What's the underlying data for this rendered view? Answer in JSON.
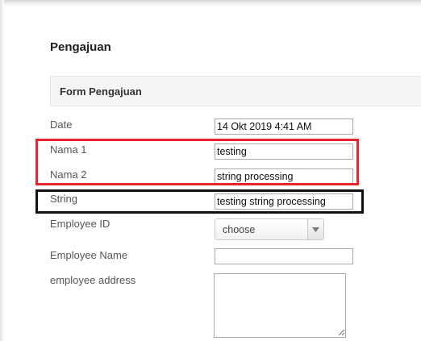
{
  "page": {
    "title": "Pengajuan"
  },
  "form": {
    "section_title": "Form Pengajuan",
    "fields": {
      "date": {
        "label": "Date",
        "value": "14 Okt 2019 4:41 AM"
      },
      "nama1": {
        "label": "Nama 1",
        "value": "testing"
      },
      "nama2": {
        "label": "Nama 2",
        "value": "string processing"
      },
      "string": {
        "label": "String",
        "value": "testing string processing"
      },
      "employee_id": {
        "label": "Employee ID",
        "selected": "choose"
      },
      "employee_name": {
        "label": "Employee Name",
        "value": ""
      },
      "employee_address": {
        "label": "employee address",
        "value": ""
      }
    }
  },
  "annotations": {
    "red_box_color": "#e8232e",
    "black_box_color": "#111111"
  },
  "icons": {
    "select_arrow": "chevron-down-icon",
    "resize": "resize-grip-icon"
  }
}
